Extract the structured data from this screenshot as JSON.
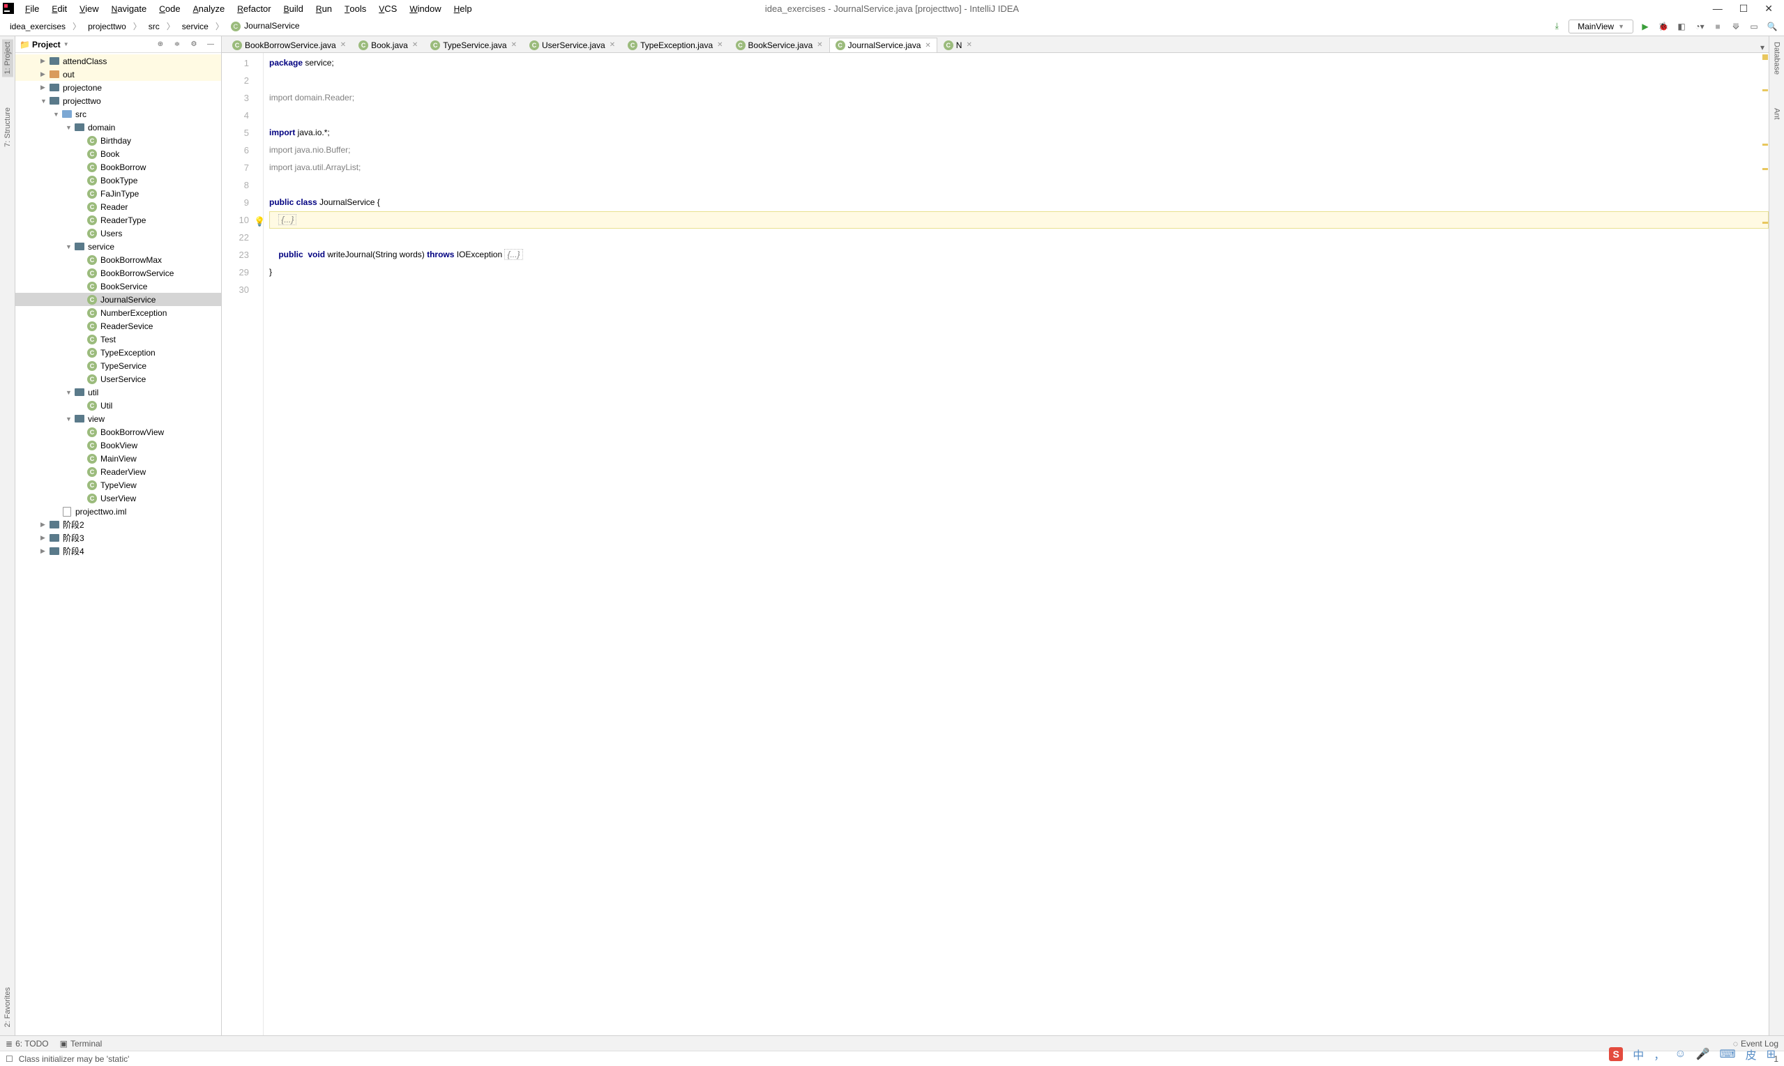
{
  "window": {
    "title": "idea_exercises - JournalService.java [projecttwo] - IntelliJ IDEA"
  },
  "menu": [
    "File",
    "Edit",
    "View",
    "Navigate",
    "Code",
    "Analyze",
    "Refactor",
    "Build",
    "Run",
    "Tools",
    "VCS",
    "Window",
    "Help"
  ],
  "breadcrumb": {
    "items": [
      "idea_exercises",
      "projecttwo",
      "src",
      "service",
      "JournalService"
    ]
  },
  "runConfig": "MainView",
  "projectPanel": {
    "title": "Project"
  },
  "tree": [
    {
      "indent": 2,
      "arrow": "right",
      "icon": "folder-dark",
      "label": "attendClass",
      "hl": "yellow"
    },
    {
      "indent": 2,
      "arrow": "right",
      "icon": "folder-orange",
      "label": "out",
      "hl": "yellow"
    },
    {
      "indent": 2,
      "arrow": "right",
      "icon": "folder-dark",
      "label": "projectone"
    },
    {
      "indent": 2,
      "arrow": "down",
      "icon": "folder-dark",
      "label": "projecttwo"
    },
    {
      "indent": 3,
      "arrow": "down",
      "icon": "folder-blue",
      "label": "src"
    },
    {
      "indent": 4,
      "arrow": "down",
      "icon": "folder-dark",
      "label": "domain"
    },
    {
      "indent": 5,
      "icon": "class",
      "label": "Birthday"
    },
    {
      "indent": 5,
      "icon": "class",
      "label": "Book"
    },
    {
      "indent": 5,
      "icon": "class",
      "label": "BookBorrow"
    },
    {
      "indent": 5,
      "icon": "class",
      "label": "BookType"
    },
    {
      "indent": 5,
      "icon": "class",
      "label": "FaJinType"
    },
    {
      "indent": 5,
      "icon": "class",
      "label": "Reader"
    },
    {
      "indent": 5,
      "icon": "class",
      "label": "ReaderType"
    },
    {
      "indent": 5,
      "icon": "class",
      "label": "Users"
    },
    {
      "indent": 4,
      "arrow": "down",
      "icon": "folder-dark",
      "label": "service"
    },
    {
      "indent": 5,
      "icon": "class",
      "label": "BookBorrowMax"
    },
    {
      "indent": 5,
      "icon": "class",
      "label": "BookBorrowService"
    },
    {
      "indent": 5,
      "icon": "class",
      "label": "BookService"
    },
    {
      "indent": 5,
      "icon": "class",
      "label": "JournalService",
      "selected": true
    },
    {
      "indent": 5,
      "icon": "class",
      "label": "NumberException"
    },
    {
      "indent": 5,
      "icon": "class",
      "label": "ReaderSevice"
    },
    {
      "indent": 5,
      "icon": "class-run",
      "label": "Test"
    },
    {
      "indent": 5,
      "icon": "class",
      "label": "TypeException"
    },
    {
      "indent": 5,
      "icon": "class",
      "label": "TypeService"
    },
    {
      "indent": 5,
      "icon": "class",
      "label": "UserService"
    },
    {
      "indent": 4,
      "arrow": "down",
      "icon": "folder-dark",
      "label": "util"
    },
    {
      "indent": 5,
      "icon": "class",
      "label": "Util"
    },
    {
      "indent": 4,
      "arrow": "down",
      "icon": "folder-dark",
      "label": "view"
    },
    {
      "indent": 5,
      "icon": "class",
      "label": "BookBorrowView"
    },
    {
      "indent": 5,
      "icon": "class",
      "label": "BookView"
    },
    {
      "indent": 5,
      "icon": "class-run",
      "label": "MainView"
    },
    {
      "indent": 5,
      "icon": "class",
      "label": "ReaderView"
    },
    {
      "indent": 5,
      "icon": "class",
      "label": "TypeView"
    },
    {
      "indent": 5,
      "icon": "class",
      "label": "UserView"
    },
    {
      "indent": 3,
      "icon": "file",
      "label": "projecttwo.iml"
    },
    {
      "indent": 2,
      "arrow": "right",
      "icon": "folder-dark",
      "label": "阶段2"
    },
    {
      "indent": 2,
      "arrow": "right",
      "icon": "folder-dark",
      "label": "阶段3"
    },
    {
      "indent": 2,
      "arrow": "right",
      "icon": "folder-dark",
      "label": "阶段4"
    }
  ],
  "tabs": [
    {
      "label": "BookBorrowService.java"
    },
    {
      "label": "Book.java"
    },
    {
      "label": "TypeService.java"
    },
    {
      "label": "UserService.java"
    },
    {
      "label": "TypeException.java"
    },
    {
      "label": "BookService.java"
    },
    {
      "label": "JournalService.java",
      "active": true
    },
    {
      "label": "N"
    }
  ],
  "code": {
    "lines": [
      {
        "n": 1,
        "html": "<span class='kw'>package</span> service;"
      },
      {
        "n": 2,
        "html": ""
      },
      {
        "n": 3,
        "html": "<span class='gray'>import domain.Reader;</span>"
      },
      {
        "n": 4,
        "html": ""
      },
      {
        "n": 5,
        "html": "<span class='kw'>import</span> java.io.*;"
      },
      {
        "n": 6,
        "html": "<span class='gray'>import java.nio.Buffer;</span>"
      },
      {
        "n": 7,
        "html": "<span class='gray'>import java.util.ArrayList;</span>"
      },
      {
        "n": 8,
        "html": ""
      },
      {
        "n": 9,
        "html": "<span class='kw'>public class</span> JournalService {"
      },
      {
        "n": 10,
        "html": "    <span class='fold'>{...}</span>",
        "current": true,
        "bulb": true
      },
      {
        "n": 22,
        "html": ""
      },
      {
        "n": 23,
        "html": "    <span class='kw'>public</span>  <span class='kw'>void</span> writeJournal(String words) <span class='kw'>throws</span> IOException <span class='fold'>{...}</span>"
      },
      {
        "n": 29,
        "html": "}"
      },
      {
        "n": 30,
        "html": ""
      }
    ]
  },
  "leftTools": [
    {
      "label": "1: Project",
      "active": true
    },
    {
      "label": "7: Structure"
    },
    {
      "label": "2: Favorites"
    }
  ],
  "rightTools": [
    {
      "label": "Database"
    },
    {
      "label": "Ant"
    }
  ],
  "bottomTools": {
    "todo": "6: TODO",
    "terminal": "Terminal",
    "eventLog": "Event Log"
  },
  "status": {
    "msg": "Class initializer may be 'static'",
    "pos": "1"
  },
  "ime": {
    "items": [
      "中",
      "，",
      "☺",
      "🎤",
      "⌨",
      "皮",
      "⊞"
    ]
  }
}
